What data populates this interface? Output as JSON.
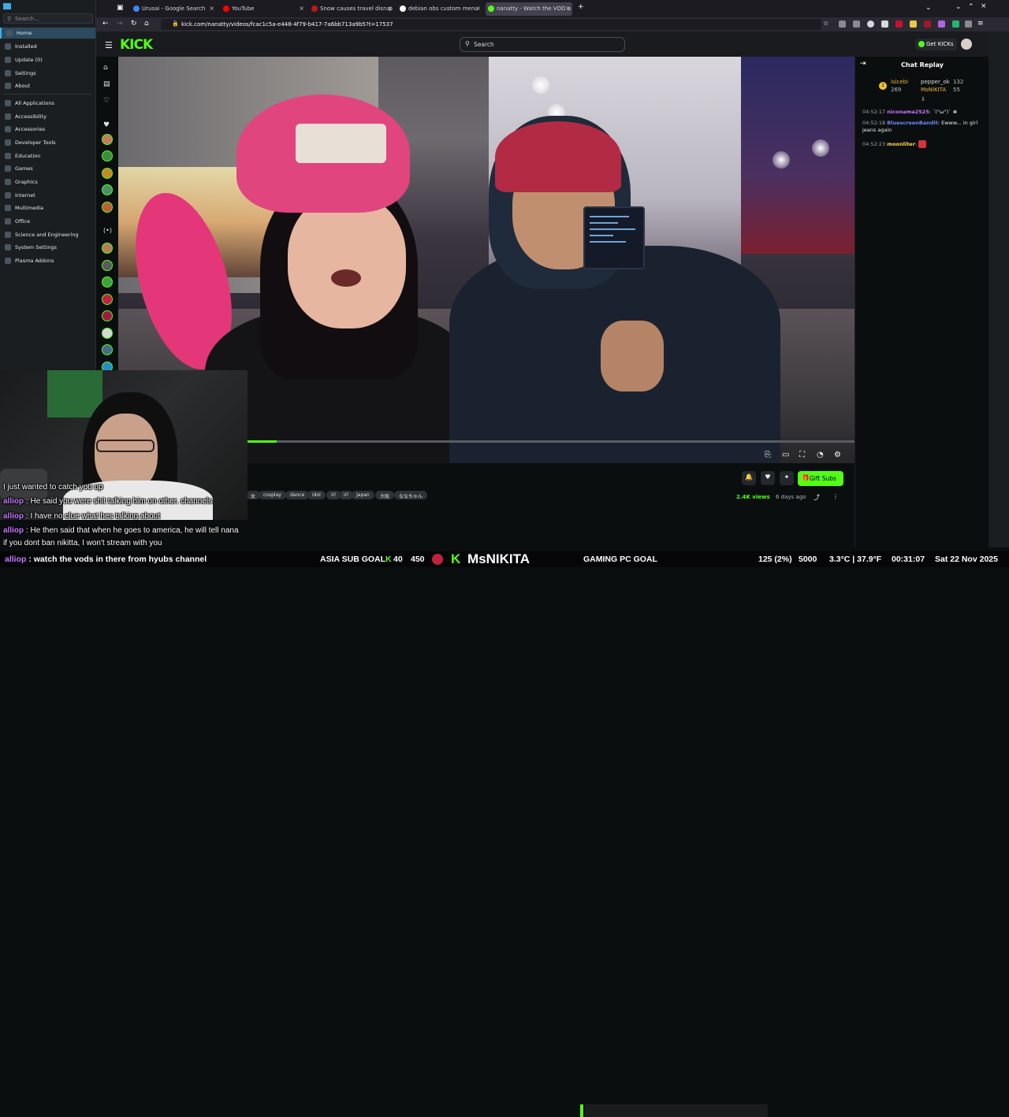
{
  "launcher": {
    "search_placeholder": "Search...",
    "items": [
      {
        "label": "Home",
        "active": true
      },
      {
        "label": "Installed"
      },
      {
        "label": "Update (0)"
      },
      {
        "label": "Settings"
      },
      {
        "label": "About"
      },
      {
        "label": "All Applications"
      },
      {
        "label": "Accessibility"
      },
      {
        "label": "Accessories"
      },
      {
        "label": "Developer Tools"
      },
      {
        "label": "Education"
      },
      {
        "label": "Games"
      },
      {
        "label": "Graphics"
      },
      {
        "label": "Internet"
      },
      {
        "label": "Multimedia"
      },
      {
        "label": "Office"
      },
      {
        "label": "Science and Engineering"
      },
      {
        "label": "System Settings"
      },
      {
        "label": "Plasma Addons"
      }
    ]
  },
  "browser": {
    "tabs": [
      {
        "title": "Urusai - Google Search",
        "favicon_color": "#4285f4"
      },
      {
        "title": "YouTube",
        "favicon_color": "#ff0000"
      },
      {
        "title": "Snow causes travel disrup",
        "favicon_color": "#bb1919"
      },
      {
        "title": "debian obs custom menu",
        "favicon_color": "#ffffff"
      },
      {
        "title": "nanatty - Watch the VOD o",
        "favicon_color": "#53fc18",
        "active": true
      }
    ],
    "new_tab": "+",
    "url": "kick.com/nanatty/videos/fcac1c5a-e448-4f79-b417-7a6bb713a9b5?t=17537"
  },
  "kick": {
    "logo": "KICK",
    "search_placeholder": "Search",
    "get_kicks": "Get KICKs",
    "progress": 0.215,
    "gift_subs": "Gift Subs",
    "tags": [
      "女",
      "cosplay",
      "dance",
      "idol",
      "irl",
      "irl",
      "Japan",
      "大阪",
      "ななちゃん"
    ],
    "views": "2.4K views",
    "ago": "6 days ago"
  },
  "chat": {
    "title": "Chat Replay",
    "leaderboard": {
      "rank1": "1",
      "user1": "isicebi",
      "pts1": "269",
      "user2": "pepper_ok",
      "pts2": "132",
      "user3": "MsNIKITA",
      "pts3": "55"
    },
    "messages": [
      {
        "time": "04:52:17",
        "user": "niconama2525",
        "text": "´(°ω°)` ❀",
        "color": "#c678ff"
      },
      {
        "time": "04:52:18",
        "user": "BluescreenBandit",
        "text": "Ewww... in girl jeans again",
        "color": "#6e8bff"
      },
      {
        "time": "04:52:23",
        "user": "moonliter",
        "text": "",
        "color": "#ffd45a"
      }
    ]
  },
  "overlay_chat": [
    {
      "user": "",
      "text": "I just wanted to catch you up"
    },
    {
      "user": "alliop",
      "text": "He said you were shit talking him on other. channels"
    },
    {
      "user": "alliop",
      "text": "I have no clue what hes talking about"
    },
    {
      "user": "alliop",
      "text": "He then said that when he goes to america, he will tell nana"
    },
    {
      "user": "",
      "text": "if you dont ban nikitta, I won't stream with you"
    }
  ],
  "ticker": {
    "chat_user": "alliop",
    "chat_text": "watch the vods in there from hyubs channel",
    "sub_goal_label": "ASIA SUB GOAL",
    "sub_goal_current": "40",
    "sub_goal_target": "450",
    "brand": "MsNIKITA",
    "pc_goal_label": "GAMING PC GOAL",
    "pc_goal_progress": "125 (2%)",
    "pc_goal_target": "5000",
    "weather": "3.3°C | 37.9°F",
    "uptime": "00:31:07",
    "date": "Sat 22 Nov 2025"
  }
}
